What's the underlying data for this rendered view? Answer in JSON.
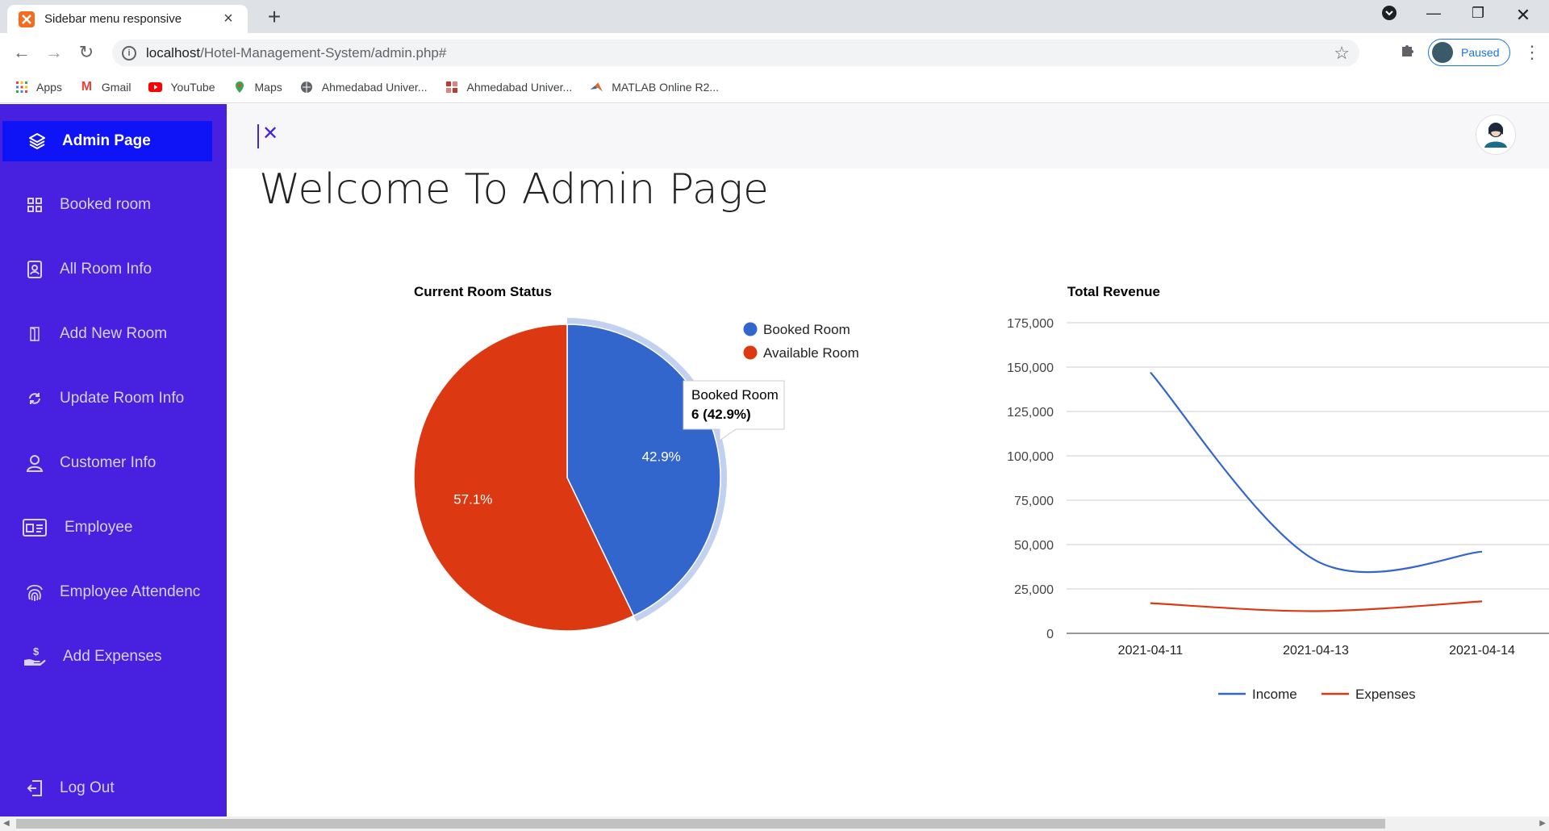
{
  "browser": {
    "tab_title": "Sidebar menu responsive",
    "url_host": "localhost",
    "url_path": "/Hotel-Management-System/admin.php#",
    "profile_label": "Paused",
    "bookmarks": [
      {
        "label": "Apps",
        "icon": "apps-grid-icon"
      },
      {
        "label": "Gmail",
        "icon": "gmail-icon"
      },
      {
        "label": "YouTube",
        "icon": "youtube-icon"
      },
      {
        "label": "Maps",
        "icon": "maps-icon"
      },
      {
        "label": "Ahmedabad Univer...",
        "icon": "globe-icon"
      },
      {
        "label": "Ahmedabad Univer...",
        "icon": "university-icon"
      },
      {
        "label": "MATLAB Online R2...",
        "icon": "matlab-icon"
      }
    ]
  },
  "sidebar": {
    "items": [
      {
        "label": "Admin Page",
        "icon": "layers-icon",
        "active": true
      },
      {
        "label": "Booked room",
        "icon": "grid-icon"
      },
      {
        "label": "All Room Info",
        "icon": "contact-book-icon"
      },
      {
        "label": "Add New Room",
        "icon": "door-icon"
      },
      {
        "label": "Update Room Info",
        "icon": "refresh-icon"
      },
      {
        "label": "Customer Info",
        "icon": "user-icon"
      },
      {
        "label": "Employee",
        "icon": "id-card-icon"
      },
      {
        "label": "Employee Attendenc",
        "icon": "fingerprint-icon"
      },
      {
        "label": "Add Expenses",
        "icon": "hand-money-icon"
      }
    ],
    "logout_label": "Log Out"
  },
  "main": {
    "heading": "Welcome To Admin Page"
  },
  "colors": {
    "sidebar": "#4720e0",
    "active": "#0e14f5",
    "booked": "#3366cc",
    "available": "#dc3912"
  },
  "chart_data": [
    {
      "type": "pie",
      "title": "Current Room Status",
      "categories": [
        "Booked Room",
        "Available Room"
      ],
      "values": [
        6,
        8
      ],
      "labels": [
        "42.9%",
        "57.1%"
      ],
      "legend": "right",
      "tooltip": {
        "name": "Booked Room",
        "value": "6 (42.9%)"
      }
    },
    {
      "type": "line",
      "title": "Total Revenue",
      "x": [
        "2021-04-11",
        "2021-04-13",
        "2021-04-14"
      ],
      "series": [
        {
          "name": "Income",
          "values": [
            147000,
            41000,
            46000
          ]
        },
        {
          "name": "Expenses",
          "values": [
            17000,
            12500,
            18000
          ]
        }
      ],
      "ylim": [
        0,
        175000
      ],
      "yticks": [
        "0",
        "25,000",
        "50,000",
        "75,000",
        "100,000",
        "125,000",
        "150,000",
        "175,000"
      ],
      "legend": "bottom",
      "grid": true
    }
  ]
}
